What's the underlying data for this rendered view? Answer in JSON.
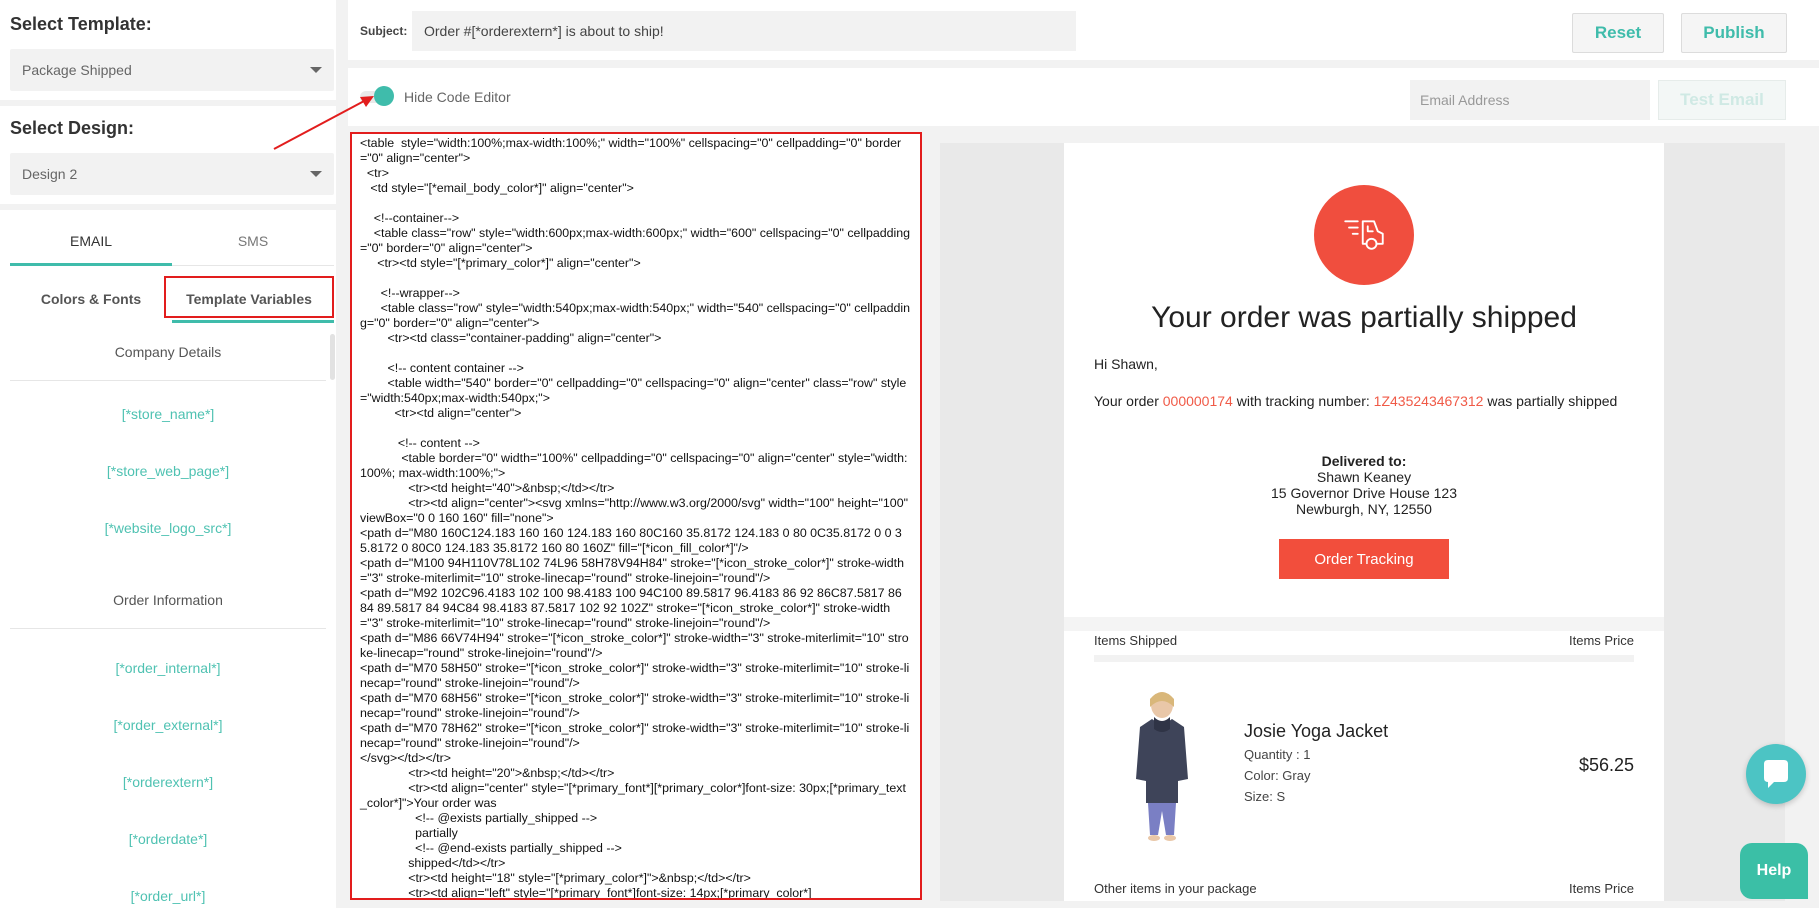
{
  "sidebar": {
    "select_template_title": "Select Template:",
    "template_value": "Package Shipped",
    "select_design_title": "Select Design:",
    "design_value": "Design 2",
    "tabs": {
      "email": "EMAIL",
      "sms": "SMS"
    },
    "subtabs": {
      "colors": "Colors & Fonts",
      "variables": "Template Variables"
    },
    "sections": {
      "company": "Company Details",
      "order": "Order Information"
    },
    "company_vars": [
      "[*store_name*]",
      "[*store_web_page*]",
      "[*website_logo_src*]"
    ],
    "order_vars": [
      "[*order_internal*]",
      "[*order_external*]",
      "[*orderextern*]",
      "[*orderdate*]",
      "[*order_url*]"
    ]
  },
  "header": {
    "subject_label": "Subject:",
    "subject_value": "Order #[*orderextern*] is about to ship!",
    "reset": "Reset",
    "publish": "Publish"
  },
  "editor_bar": {
    "toggle_label": "Hide Code Editor",
    "email_placeholder": "Email Address",
    "test_email": "Test Email"
  },
  "code": "<table  style=\"width:100%;max-width:100%;\" width=\"100%\" cellspacing=\"0\" cellpadding=\"0\" border=\"0\" align=\"center\">\n  <tr>\n   <td style=\"[*email_body_color*]\" align=\"center\">\n\n    <!--container-->\n    <table class=\"row\" style=\"width:600px;max-width:600px;\" width=\"600\" cellspacing=\"0\" cellpadding=\"0\" border=\"0\" align=\"center\">\n     <tr><td style=\"[*primary_color*]\" align=\"center\">\n\n      <!--wrapper-->\n      <table class=\"row\" style=\"width:540px;max-width:540px;\" width=\"540\" cellspacing=\"0\" cellpadding=\"0\" border=\"0\" align=\"center\">\n        <tr><td class=\"container-padding\" align=\"center\">\n\n        <!-- content container -->\n        <table width=\"540\" border=\"0\" cellpadding=\"0\" cellspacing=\"0\" align=\"center\" class=\"row\" style=\"width:540px;max-width:540px;\">\n          <tr><td align=\"center\">\n\n           <!-- content -->\n            <table border=\"0\" width=\"100%\" cellpadding=\"0\" cellspacing=\"0\" align=\"center\" style=\"width:100%; max-width:100%;\">\n              <tr><td height=\"40\">&nbsp;</td></tr>\n              <tr><td align=\"center\"><svg xmlns=\"http://www.w3.org/2000/svg\" width=\"100\" height=\"100\" viewBox=\"0 0 160 160\" fill=\"none\">\n<path d=\"M80 160C124.183 160 160 124.183 160 80C160 35.8172 124.183 0 80 0C35.8172 0 0 35.8172 0 80C0 124.183 35.8172 160 80 160Z\" fill=\"[*icon_fill_color*]\"/>\n<path d=\"M100 94H110V78L102 74L96 58H78V94H84\" stroke=\"[*icon_stroke_color*]\" stroke-width=\"3\" stroke-miterlimit=\"10\" stroke-linecap=\"round\" stroke-linejoin=\"round\"/>\n<path d=\"M92 102C96.4183 102 100 98.4183 100 94C100 89.5817 96.4183 86 92 86C87.5817 86 84 89.5817 84 94C84 98.4183 87.5817 102 92 102Z\" stroke=\"[*icon_stroke_color*]\" stroke-width=\"3\" stroke-miterlimit=\"10\" stroke-linecap=\"round\" stroke-linejoin=\"round\"/>\n<path d=\"M86 66V74H94\" stroke=\"[*icon_stroke_color*]\" stroke-width=\"3\" stroke-miterlimit=\"10\" stroke-linecap=\"round\" stroke-linejoin=\"round\"/>\n<path d=\"M70 58H50\" stroke=\"[*icon_stroke_color*]\" stroke-width=\"3\" stroke-miterlimit=\"10\" stroke-linecap=\"round\" stroke-linejoin=\"round\"/>\n<path d=\"M70 68H56\" stroke=\"[*icon_stroke_color*]\" stroke-width=\"3\" stroke-miterlimit=\"10\" stroke-linecap=\"round\" stroke-linejoin=\"round\"/>\n<path d=\"M70 78H62\" stroke=\"[*icon_stroke_color*]\" stroke-width=\"3\" stroke-miterlimit=\"10\" stroke-linecap=\"round\" stroke-linejoin=\"round\"/>\n</svg></td></tr>\n              <tr><td height=\"20\">&nbsp;</td></tr>\n              <tr><td align=\"center\" style=\"[*primary_font*][*primary_color*]font-size: 30px;[*primary_text_color*]\">Your order was\n                <!-- @exists partially_shipped -->\n                partially\n                <!-- @end-exists partially_shipped -->\n              shipped</td></tr>\n              <tr><td height=\"18\" style=\"[*primary_color*]\">&nbsp;</td></tr>\n              <tr><td align=\"left\" style=\"[*primary_font*]font-size: 14px;[*primary_color*]",
  "preview": {
    "headline": "Your order was partially shipped",
    "greeting": "Hi Shawn,",
    "line_prefix": "Your order",
    "order_number": "000000174",
    "line_mid": "with tracking number:",
    "tracking_number": "1Z435243467312",
    "line_suffix": "was partially shipped",
    "delivered_label": "Delivered to:",
    "delivered_name": "Shawn Keaney",
    "delivered_street": "15 Governor Drive House 123",
    "delivered_city": "Newburgh, NY, 12550",
    "tracking_button": "Order Tracking",
    "items_shipped": "Items Shipped",
    "items_price": "Items Price",
    "product_name": "Josie Yoga Jacket",
    "quantity": "Quantity : 1",
    "color": "Color: Gray",
    "size": "Size: S",
    "price": "$56.25",
    "other_items": "Other items in your package",
    "other_price": "Items Price"
  },
  "floating": {
    "help": "Help"
  },
  "colors": {
    "accent": "#3fbcab",
    "brand_red": "#f24e3c",
    "annotation": "#e21d1d"
  }
}
